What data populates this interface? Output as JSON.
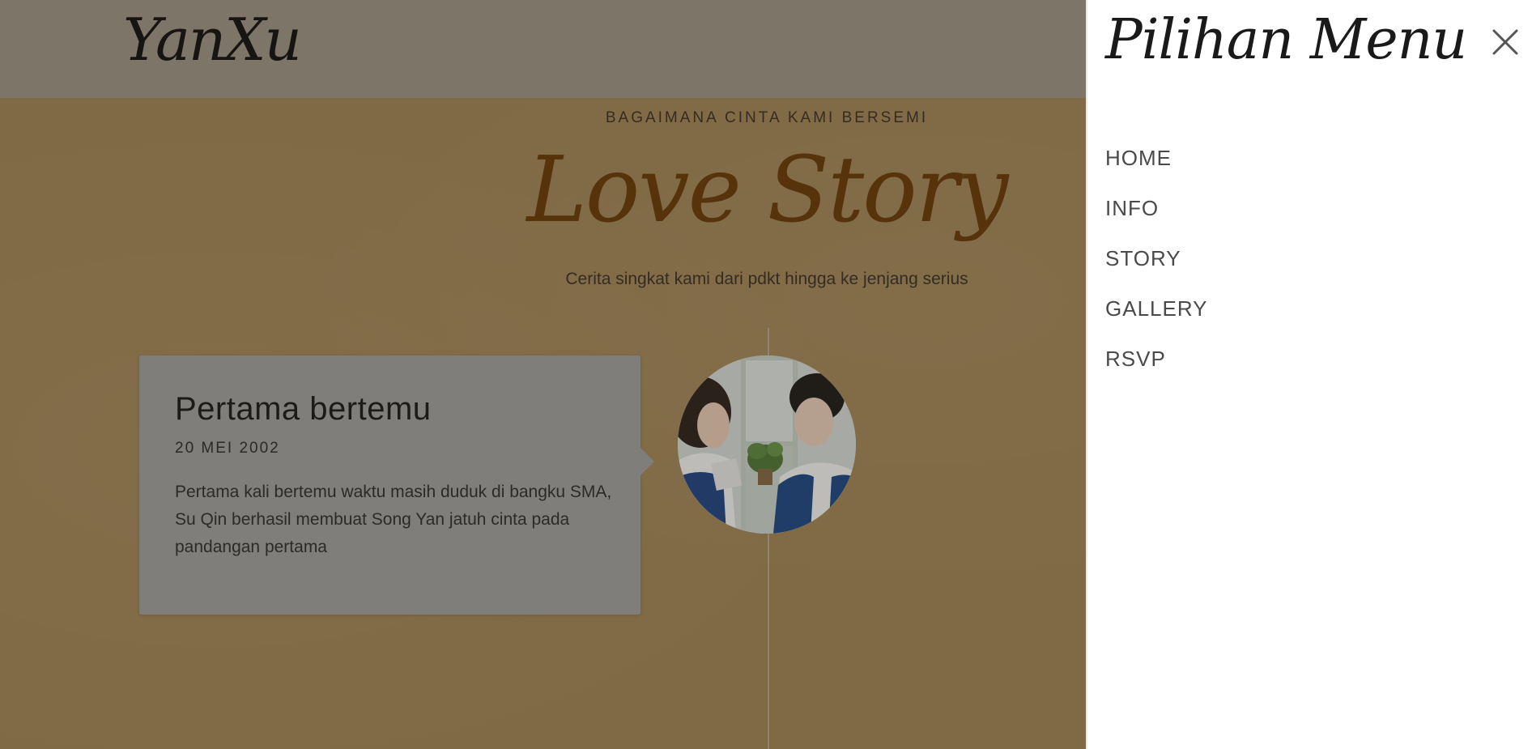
{
  "header": {
    "brand": "YanXu"
  },
  "story_section": {
    "kicker": "BAGAIMANA CINTA KAMI BERSEMI",
    "title": "Love Story",
    "subtitle": "Cerita singkat kami dari pdkt hingga ke jenjang serius",
    "events": [
      {
        "title": "Pertama bertemu",
        "date": "20 MEI 2002",
        "description": "Pertama kali bertemu waktu masih duduk di bangku SMA, Su Qin berhasil membuat Song Yan jatuh cinta pada pandangan pertama"
      }
    ]
  },
  "menu": {
    "title": "Pilihan Menu",
    "close_icon": "close-icon",
    "items": [
      {
        "label": "HOME"
      },
      {
        "label": "INFO"
      },
      {
        "label": "STORY"
      },
      {
        "label": "GALLERY"
      },
      {
        "label": "RSVP"
      }
    ]
  },
  "colors": {
    "page_background": "#a78a5b",
    "topbar": "#a29a8b",
    "title_brown": "#6a3b06",
    "card": "#a6a6a6",
    "menu_background": "#ffffff"
  }
}
